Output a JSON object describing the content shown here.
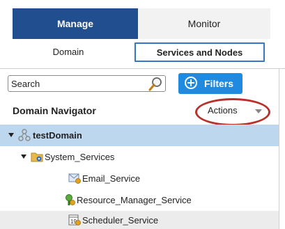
{
  "top_tabs": {
    "manage": "Manage",
    "monitor": "Monitor"
  },
  "sub_tabs": {
    "domain": "Domain",
    "services_and_nodes": "Services and Nodes"
  },
  "search": {
    "placeholder": "Search"
  },
  "filters": {
    "label": "Filters"
  },
  "navigator": {
    "title": "Domain Navigator",
    "actions": "Actions"
  },
  "tree": [
    {
      "label": "testDomain",
      "icon": "domain-icon",
      "state": "selected",
      "expanded": true
    },
    {
      "label": "System_Services",
      "icon": "folder-services-icon",
      "expanded": true
    },
    {
      "label": "Email_Service",
      "icon": "email-service-icon"
    },
    {
      "label": "Resource_Manager_Service",
      "icon": "resource-manager-icon"
    },
    {
      "label": "Scheduler_Service",
      "icon": "scheduler-icon",
      "state": "hover"
    }
  ],
  "colors": {
    "manage_tab": "#204e8e",
    "filters_button": "#1f8ae0",
    "selected_row": "#bcd7ee",
    "highlight_ring": "#b8302a"
  }
}
